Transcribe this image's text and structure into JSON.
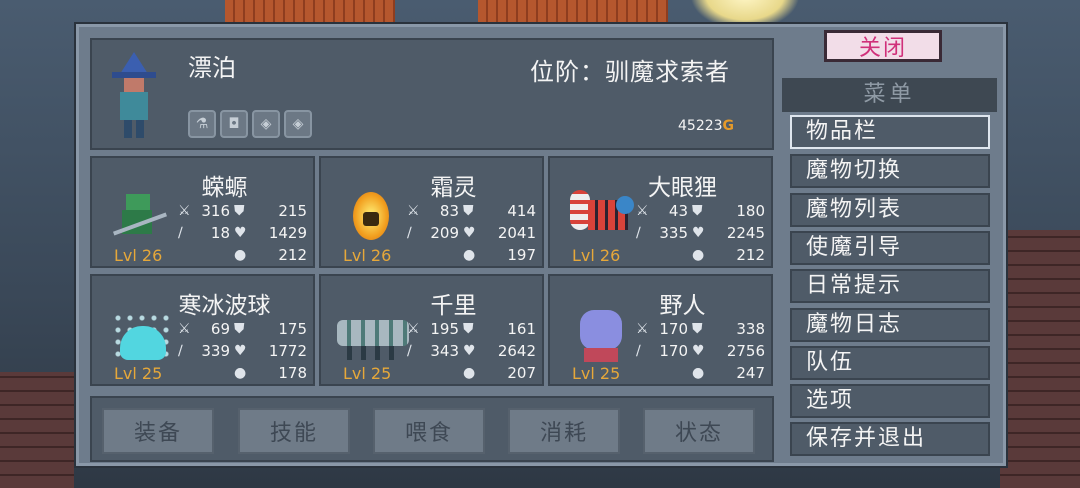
{
  "header": {
    "hero_name": "漂泊",
    "rank_label": "位阶：驯魔求索者",
    "gold": "45223",
    "gold_symbol": "G",
    "badges": [
      "⚗",
      "◘",
      "◈",
      "◈"
    ]
  },
  "monsters": [
    {
      "name": "蝾螈",
      "level": "Lvl 26",
      "atk": "316",
      "def": "215",
      "mag": "18",
      "hp": "1429",
      "res": "212"
    },
    {
      "name": "霜灵",
      "level": "Lvl 26",
      "atk": "83",
      "def": "414",
      "mag": "209",
      "hp": "2041",
      "res": "197"
    },
    {
      "name": "大眼狸",
      "level": "Lvl 26",
      "atk": "43",
      "def": "180",
      "mag": "335",
      "hp": "2245",
      "res": "212"
    },
    {
      "name": "寒冰波球",
      "level": "Lvl 25",
      "atk": "69",
      "def": "175",
      "mag": "339",
      "hp": "1772",
      "res": "178"
    },
    {
      "name": "千里",
      "level": "Lvl 25",
      "atk": "195",
      "def": "161",
      "mag": "343",
      "hp": "2642",
      "res": "207"
    },
    {
      "name": "野人",
      "level": "Lvl 25",
      "atk": "170",
      "def": "338",
      "mag": "170",
      "hp": "2756",
      "res": "247"
    }
  ],
  "tabs": [
    "装备",
    "技能",
    "喂食",
    "消耗",
    "状态"
  ],
  "close_label": "关闭",
  "menu": {
    "title": "菜单",
    "items": [
      "物品栏",
      "魔物切换",
      "魔物列表",
      "使魔引导",
      "日常提示",
      "魔物日志",
      "队伍",
      "选项",
      "保存并退出"
    ]
  },
  "colors": {
    "level": "#e6a83a",
    "close_text": "#d0307a",
    "gold_coin": "#e59a2a"
  }
}
